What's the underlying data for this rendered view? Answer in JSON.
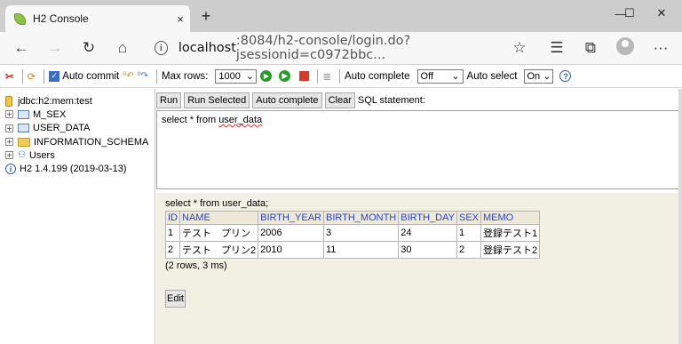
{
  "browser": {
    "tab_title": "H2 Console",
    "tab_close": "×",
    "new_tab": "+",
    "minimize": "—",
    "maximize": "☐",
    "close": "✕",
    "url_host": "localhost",
    "url_path": ":8084/h2-console/login.do?jsessionid=c0972bbc...",
    "more": "···"
  },
  "toolbar": {
    "auto_commit_label": "Auto commit",
    "max_rows_label": "Max rows:",
    "max_rows_value": "1000",
    "auto_complete_label": "Auto complete",
    "auto_complete_value": "Off",
    "auto_select_label": "Auto select",
    "auto_select_value": "On",
    "help": "?"
  },
  "sidebar": {
    "connection": "jdbc:h2:mem:test",
    "items": [
      {
        "label": "M_SEX",
        "type": "table"
      },
      {
        "label": "USER_DATA",
        "type": "table"
      },
      {
        "label": "INFORMATION_SCHEMA",
        "type": "folder"
      },
      {
        "label": "Users",
        "type": "users"
      }
    ],
    "version": "H2 1.4.199 (2019-03-13)"
  },
  "main": {
    "buttons": {
      "run": "Run",
      "run_selected": "Run Selected",
      "auto_complete": "Auto complete",
      "clear": "Clear"
    },
    "sql_label": "SQL statement:",
    "sql_prefix": "select * from ",
    "sql_table": "user_data",
    "result_query": "select * from user_data;",
    "columns": [
      "ID",
      "NAME",
      "BIRTH_YEAR",
      "BIRTH_MONTH",
      "BIRTH_DAY",
      "SEX",
      "MEMO"
    ],
    "rows": [
      [
        "1",
        "テスト　プリン",
        "2006",
        "3",
        "24",
        "1",
        "登録テスト1"
      ],
      [
        "2",
        "テスト　プリン2",
        "2010",
        "11",
        "30",
        "2",
        "登録テスト2"
      ]
    ],
    "row_info": "(2 rows, 3 ms)",
    "edit": "Edit"
  }
}
